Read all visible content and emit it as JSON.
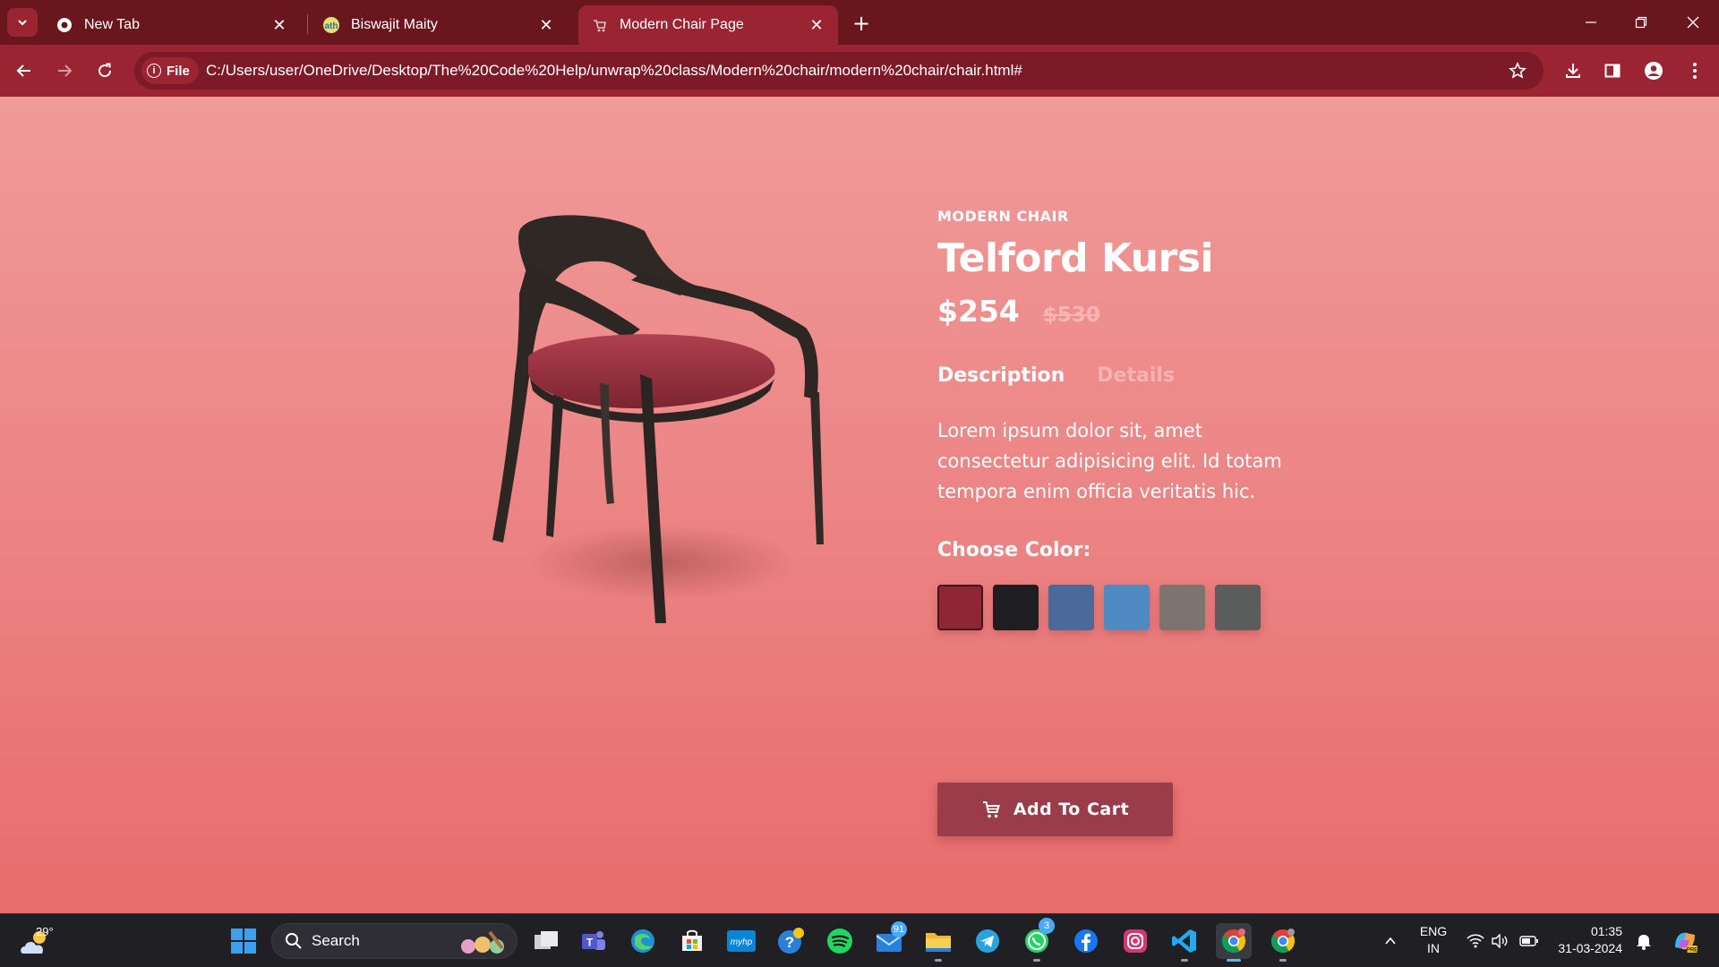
{
  "browser": {
    "tabs": [
      {
        "title": "New Tab",
        "icon": "chrome-icon",
        "active": false
      },
      {
        "title": "Biswajit Maity",
        "icon": "site-favicon-icon",
        "active": false
      },
      {
        "title": "Modern Chair Page",
        "icon": "cart-favicon-icon",
        "active": true
      }
    ],
    "new_tab_label": "+",
    "file_chip": "File",
    "url": "C:/Users/user/OneDrive/Desktop/The%20Code%20Help/unwrap%20class/Modern%20chair/modern%20chair/chair.html#"
  },
  "product": {
    "eyebrow": "MODERN CHAIR",
    "title": "Telford Kursi",
    "price": "$254",
    "old_price": "$530",
    "tabs": [
      "Description",
      "Details"
    ],
    "active_tab": "Description",
    "description": "Lorem ipsum dolor sit, amet consectetur adipisicing elit. Id totam tempora enim officia veritatis hic.",
    "color_label": "Choose Color:",
    "colors": [
      "#8e2634",
      "#1e1e20",
      "#4a6a9a",
      "#4f8ac2",
      "#7d7470",
      "#5a5d5b"
    ],
    "selected_color": 0,
    "cart_label": "Add To Cart"
  },
  "taskbar": {
    "temperature": "29°",
    "search_placeholder": "Search",
    "mail_badge": "91",
    "whatsapp_badge": "3",
    "lang_line1": "ENG",
    "lang_line2": "IN",
    "time": "01:35",
    "date": "31-03-2024"
  },
  "colors": {
    "tabbar": "#6a161d",
    "toolbar": "#9b2433",
    "page_top": "#f09a9a",
    "page_bottom": "#e86c6c",
    "cart_button": "#9a3c4a",
    "taskbar": "#1f1f24"
  }
}
